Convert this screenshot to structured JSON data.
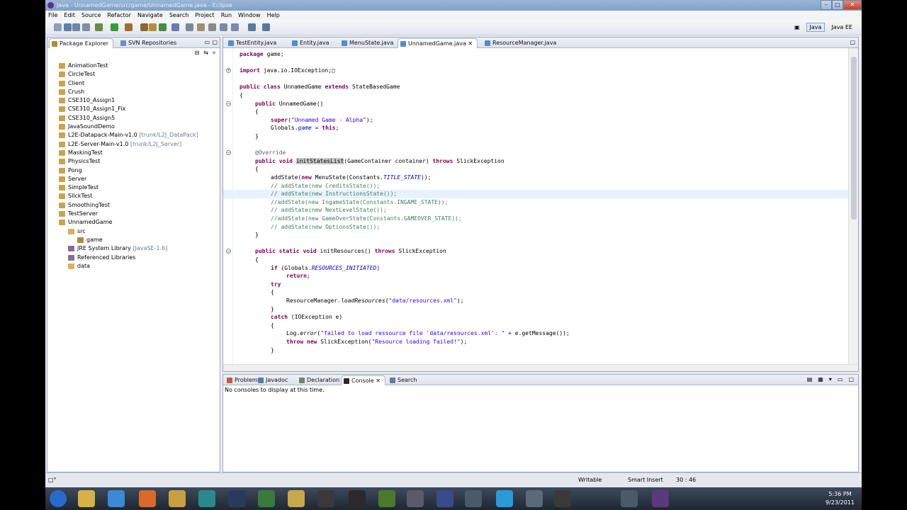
{
  "window": {
    "title": "Java - UnnamedGame/src/game/UnnamedGame.java - Eclipse"
  },
  "menu": [
    "File",
    "Edit",
    "Source",
    "Refactor",
    "Navigate",
    "Search",
    "Project",
    "Run",
    "Window",
    "Help"
  ],
  "perspectives": {
    "java": "Java",
    "javaee": "Java EE"
  },
  "explorer": {
    "tabs": [
      "Package Explorer",
      "SVN Repositories"
    ],
    "items": [
      {
        "label": "AnimationTest",
        "decoration": "",
        "depth": 0,
        "icon": "project-icon"
      },
      {
        "label": "CircleTest",
        "decoration": "",
        "depth": 0,
        "icon": "project-icon"
      },
      {
        "label": "Client",
        "decoration": "",
        "depth": 0,
        "icon": "project-icon"
      },
      {
        "label": "Crush",
        "decoration": "",
        "depth": 0,
        "icon": "project-icon"
      },
      {
        "label": "CSE310_Assign1",
        "decoration": "",
        "depth": 0,
        "icon": "project-icon"
      },
      {
        "label": "CSE310_Assign1_Fix",
        "decoration": "",
        "depth": 0,
        "icon": "project-icon"
      },
      {
        "label": "CSE310_Assign5",
        "decoration": "",
        "depth": 0,
        "icon": "project-icon"
      },
      {
        "label": "JavaSoundDemo",
        "decoration": "",
        "depth": 0,
        "icon": "project-icon"
      },
      {
        "label": "L2E-Datapack-Main-v1.0",
        "decoration": "[trunk/L2J_DataPack]",
        "depth": 0,
        "icon": "project-icon"
      },
      {
        "label": "L2E-Server-Main-v1.0",
        "decoration": "[trunk/L2J_Server]",
        "depth": 0,
        "icon": "project-icon"
      },
      {
        "label": "MaskingTest",
        "decoration": "",
        "depth": 0,
        "icon": "project-icon"
      },
      {
        "label": "PhysicsTest",
        "decoration": "",
        "depth": 0,
        "icon": "project-icon"
      },
      {
        "label": "Pong",
        "decoration": "",
        "depth": 0,
        "icon": "project-icon"
      },
      {
        "label": "Server",
        "decoration": "",
        "depth": 0,
        "icon": "project-icon"
      },
      {
        "label": "SimpleTest",
        "decoration": "",
        "depth": 0,
        "icon": "project-icon"
      },
      {
        "label": "SlickTest",
        "decoration": "",
        "depth": 0,
        "icon": "project-icon"
      },
      {
        "label": "SmoothingTest",
        "decoration": "",
        "depth": 0,
        "icon": "project-icon"
      },
      {
        "label": "TestServer",
        "decoration": "",
        "depth": 0,
        "icon": "project-icon"
      },
      {
        "label": "UnnamedGame",
        "decoration": "",
        "depth": 0,
        "icon": "project-icon"
      },
      {
        "label": "src",
        "decoration": "",
        "depth": 1,
        "icon": "source-folder-icon"
      },
      {
        "label": "game",
        "decoration": "",
        "depth": 2,
        "icon": "package-icon"
      },
      {
        "label": "JRE System Library",
        "decoration": "[JavaSE-1.6]",
        "depth": 1,
        "icon": "library-icon"
      },
      {
        "label": "Referenced Libraries",
        "decoration": "",
        "depth": 1,
        "icon": "library-icon"
      },
      {
        "label": "data",
        "decoration": "",
        "depth": 1,
        "icon": "folder-icon"
      }
    ]
  },
  "editor": {
    "tabs": [
      "TestEntity.java",
      "Entity.java",
      "MenuState.java",
      "UnnamedGame.java",
      "ResourceManager.java"
    ],
    "active_tab": 3,
    "lines": [
      {
        "t": "package game;",
        "i": 0
      },
      {
        "t": "",
        "i": 0
      },
      {
        "t": "import java.io.IOException;□",
        "i": 0,
        "fold": "+"
      },
      {
        "t": "",
        "i": 0
      },
      {
        "t": "public class UnnamedGame extends StateBasedGame",
        "i": 0
      },
      {
        "t": "{",
        "i": 0
      },
      {
        "t": "public UnnamedGame()",
        "i": 1,
        "fold": "-"
      },
      {
        "t": "{",
        "i": 1
      },
      {
        "t": "super(\"Unnamed Game - Alpha\");",
        "i": 2
      },
      {
        "t": "Globals.game = this;",
        "i": 2
      },
      {
        "t": "}",
        "i": 1
      },
      {
        "t": "",
        "i": 0
      },
      {
        "t": "@Override",
        "i": 1,
        "fold": "-"
      },
      {
        "t": "public void initStatesList(GameContainer container) throws SlickException",
        "i": 1
      },
      {
        "t": "{",
        "i": 1
      },
      {
        "t": "addState(new MenuState(Constants.TITLE_STATE));",
        "i": 2
      },
      {
        "t": "// addState(new CreditsState());",
        "i": 2
      },
      {
        "t": "// addState(new InstructionsState());",
        "i": 2
      },
      {
        "t": "//addState(new IngameState(Constants.INGAME_STATE));",
        "i": 2
      },
      {
        "t": "// addState(new NextLevelState());",
        "i": 2
      },
      {
        "t": "//addState(new GameOverState(Constants.GAMEOVER_STATE));",
        "i": 2
      },
      {
        "t": "// addState(new OptionsState());",
        "i": 2
      },
      {
        "t": "}",
        "i": 1
      },
      {
        "t": "",
        "i": 0
      },
      {
        "t": "public static void initResources() throws SlickException",
        "i": 1,
        "fold": "-"
      },
      {
        "t": "{",
        "i": 1
      },
      {
        "t": "if (Globals.RESOURCES_INITIATED)",
        "i": 2
      },
      {
        "t": "return;",
        "i": 3
      },
      {
        "t": "try",
        "i": 2
      },
      {
        "t": "{",
        "i": 2
      },
      {
        "t": "ResourceManager.loadResources(\"data/resources.xml\");",
        "i": 3
      },
      {
        "t": "}",
        "i": 2
      },
      {
        "t": "catch (IOException e)",
        "i": 2
      },
      {
        "t": "{",
        "i": 2
      },
      {
        "t": "Log.error(\"failed to load ressource file 'data/resources.xml': \" + e.getMessage());",
        "i": 3
      },
      {
        "t": "throw new SlickException(\"Resource loading failed!\");",
        "i": 3
      },
      {
        "t": "}",
        "i": 2
      }
    ],
    "current_line": 17
  },
  "bottom": {
    "tabs": [
      "Problems",
      "Javadoc",
      "Declaration",
      "Console",
      "Search"
    ],
    "active_tab": 3,
    "message": "No consoles to display at this time."
  },
  "status": {
    "writable": "Writable",
    "insert_mode": "Smart Insert",
    "position": "30 : 46",
    "left": "□°"
  },
  "clock": {
    "time": "5:36 PM",
    "date": "9/23/2011"
  }
}
